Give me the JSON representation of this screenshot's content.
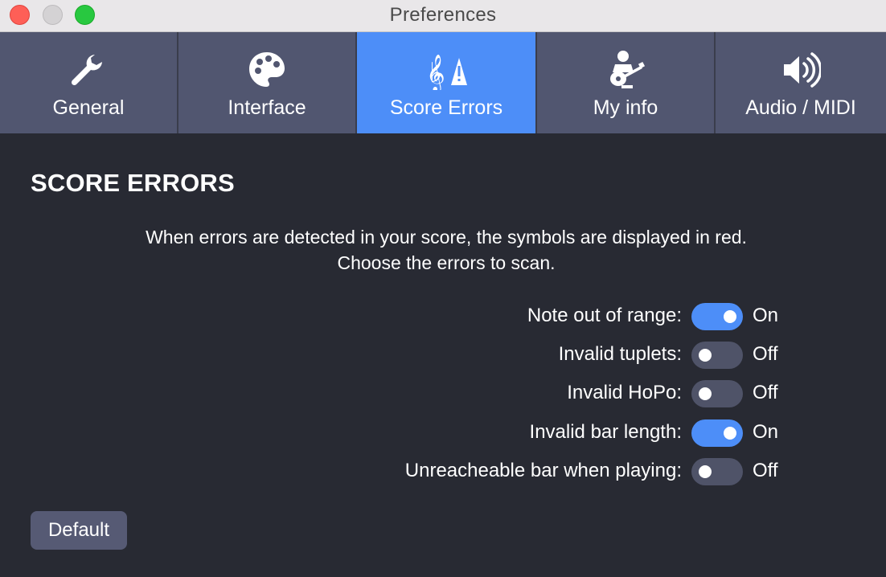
{
  "window": {
    "title": "Preferences"
  },
  "tabs": [
    {
      "label": "General",
      "icon": "wrench-icon",
      "active": false
    },
    {
      "label": "Interface",
      "icon": "palette-icon",
      "active": false
    },
    {
      "label": "Score Errors",
      "icon": "clef-warning-icon",
      "active": true
    },
    {
      "label": "My info",
      "icon": "guitarist-icon",
      "active": false
    },
    {
      "label": "Audio / MIDI",
      "icon": "speaker-icon",
      "active": false
    }
  ],
  "section": {
    "heading": "SCORE ERRORS",
    "description_line1": "When errors are detected in your score, the symbols are displayed in red.",
    "description_line2": "Choose the errors to scan."
  },
  "options": [
    {
      "label": "Note out of range:",
      "state": "On",
      "enabled": true
    },
    {
      "label": "Invalid tuplets:",
      "state": "Off",
      "enabled": false
    },
    {
      "label": "Invalid HoPo:",
      "state": "Off",
      "enabled": false
    },
    {
      "label": "Invalid bar length:",
      "state": "On",
      "enabled": true
    },
    {
      "label": "Unreacheable bar when playing:",
      "state": "Off",
      "enabled": false
    }
  ],
  "buttons": {
    "default_label": "Default"
  },
  "colors": {
    "accent": "#4d8ef8",
    "tab_background": "#515670",
    "content_background": "#282a33",
    "toggle_off": "#4f5368",
    "button_background": "#565a74"
  }
}
